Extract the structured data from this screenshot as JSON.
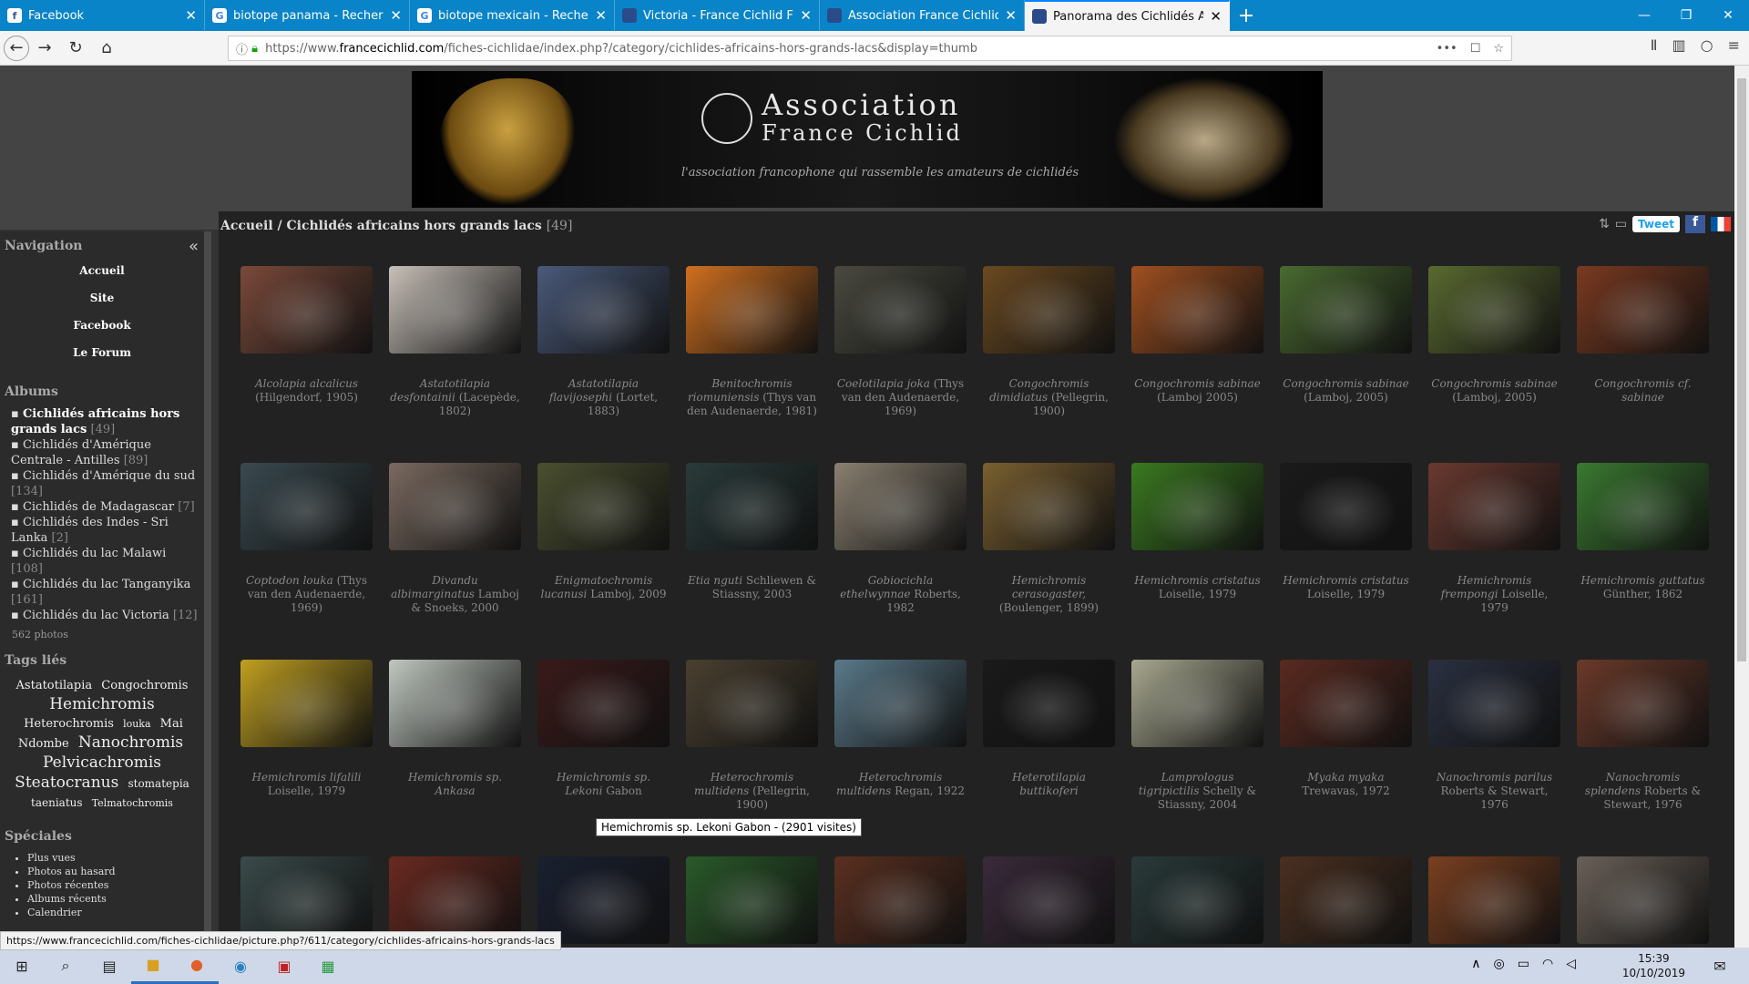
{
  "browser": {
    "tabs": [
      {
        "title": "Facebook",
        "icon": "facebook-icon"
      },
      {
        "title": "biotope panama - Recherche G",
        "icon": "google-icon"
      },
      {
        "title": "biotope mexicain - Recherche G",
        "icon": "google-icon"
      },
      {
        "title": "Victoria - France Cichlid Forum",
        "icon": "afc-icon"
      },
      {
        "title": "Association France Cichlid: les",
        "icon": "afc-icon"
      },
      {
        "title": "Panorama des Cichlidés AFC",
        "icon": "afc-icon",
        "active": true
      }
    ],
    "url_prefix": "https://www.",
    "url_domain": "francecichlid.com",
    "url_path": "/fiches-cichlidae/index.php?/category/cichlides-africains-hors-grands-lacs&display=thumb",
    "more": "•••"
  },
  "banner": {
    "line1": "Association",
    "line2": "France Cichlid",
    "tagline": "l'association francophone qui rassemble les amateurs de cichlidés"
  },
  "sidebar": {
    "nav_title": "Navigation",
    "nav": [
      "Accueil",
      "Site",
      "Facebook",
      "Le Forum"
    ],
    "albums_title": "Albums",
    "albums": [
      {
        "label": "Cichlidés africains hors grands lacs",
        "count": "[49]",
        "bold": true
      },
      {
        "label": "Cichlidés d'Amérique Centrale - Antilles",
        "count": "[89]"
      },
      {
        "label": "Cichlidés d'Amérique du sud",
        "count": "[134]"
      },
      {
        "label": "Cichlidés de Madagascar",
        "count": "[7]"
      },
      {
        "label": "Cichlidés des Indes - Sri Lanka",
        "count": "[2]"
      },
      {
        "label": "Cichlidés du lac Malawi",
        "count": "[108]"
      },
      {
        "label": "Cichlidés du lac Tanganyika",
        "count": "[161]"
      },
      {
        "label": "Cichlidés du lac Victoria",
        "count": "[12]"
      }
    ],
    "photos": "562 photos",
    "tags_title": "Tags liés",
    "tags": [
      "Astatotilapia",
      "Congochromis",
      "Hemichromis",
      "Heterochromis",
      "louka",
      "Mai Ndombe",
      "Nanochromis",
      "Pelvicachromis",
      "Steatocranus",
      "stomatepia",
      "taeniatus",
      "Telmatochromis"
    ],
    "special_title": "Spéciales",
    "special": [
      "Plus vues",
      "Photos au hasard",
      "Photos récentes",
      "Albums récents",
      "Calendrier"
    ]
  },
  "content": {
    "crumb_home": "Accueil",
    "crumb_sep": " / ",
    "crumb_cat": "Cichlidés africains hors grands lacs",
    "crumb_count": "[49]",
    "tweet": "Tweet",
    "tooltip": "Hemichromis sp. Lekoni Gabon - (2901 visites)",
    "status": "https://www.francecichlid.com/fiches-cichlidae/picture.php?/611/category/cichlides-africains-hors-grands-lacs",
    "photos": [
      {
        "name": "Alcolapia alcalicus",
        "auth": "(Hilgendorf, 1905)",
        "c": "#7a4a3a"
      },
      {
        "name": "Astatotilapia desfontainii",
        "auth": "(Lacepède, 1802)",
        "c": "#c8c0b8"
      },
      {
        "name": "Astatotilapia flavijosephi",
        "auth": "(Lortet, 1883)",
        "c": "#4a5a7a"
      },
      {
        "name": "Benitochromis riomuniensis",
        "auth": "(Thys van den Audenaerde, 1981)",
        "c": "#d07020"
      },
      {
        "name": "Coelotilapia joka",
        "auth": "(Thys van den Audenaerde, 1969)",
        "c": "#4a4a40"
      },
      {
        "name": "Congochromis dimidiatus",
        "auth": "(Pellegrin, 1900)",
        "c": "#6a4a20"
      },
      {
        "name": "Congochromis sabinae",
        "auth": "(Lamboj 2005)",
        "c": "#a05020"
      },
      {
        "name": "Congochromis sabinae",
        "auth": "(Lamboj, 2005)",
        "c": "#4a6a30"
      },
      {
        "name": "Congochromis sabinae",
        "auth": "(Lamboj, 2005)",
        "c": "#5a6a30"
      },
      {
        "name": "Congochromis cf. sabinae",
        "auth": "",
        "c": "#7a3a20"
      },
      {
        "name": "Coptodon louka",
        "auth": "(Thys van den Audenaerde, 1969)",
        "c": "#3a4a50"
      },
      {
        "name": "Divandu albimarginatus",
        "auth": "Lamboj & Snoeks, 2000",
        "c": "#7a6a60"
      },
      {
        "name": "Enigmatochromis lucanusi",
        "auth": "Lamboj, 2009",
        "c": "#4a5030"
      },
      {
        "name": "Etia nguti",
        "auth": "Schliewen & Stiassny, 2003",
        "c": "#2a3a3a"
      },
      {
        "name": "Gobiocichla ethelwynnae",
        "auth": "Roberts, 1982",
        "c": "#8a8070"
      },
      {
        "name": "Hemichromis cerasogaster,",
        "auth": "(Boulenger, 1899)",
        "c": "#7a6030"
      },
      {
        "name": "Hemichromis cristatus",
        "auth": "Loiselle, 1979",
        "c": "#3a7a20"
      },
      {
        "name": "Hemichromis cristatus",
        "auth": "Loiselle, 1979",
        "c": "#1a1a1a"
      },
      {
        "name": "Hemichromis frempongi",
        "auth": "Loiselle, 1979",
        "c": "#6a3a30"
      },
      {
        "name": "Hemichromis guttatus",
        "auth": "Günther, 1862",
        "c": "#3a7a30"
      },
      {
        "name": "Hemichromis lifalili",
        "auth": "Loiselle, 1979",
        "c": "#c0a020"
      },
      {
        "name": "Hemichromis sp. Ankasa",
        "auth": "",
        "c": "#c0c8c0"
      },
      {
        "name": "Hemichromis sp. Lekoni",
        "auth": "Gabon",
        "c": "#3a1a1a"
      },
      {
        "name": "Heterochromis multidens",
        "auth": "(Pellegrin, 1900)",
        "c": "#4a4030"
      },
      {
        "name": "Heterochromis multidens",
        "auth": "Regan, 1922",
        "c": "#5a7a8a"
      },
      {
        "name": "Heterotilapia buttikoferi",
        "auth": "",
        "c": "#1a1a1a"
      },
      {
        "name": "Lamprologus tigripictilis",
        "auth": "Schelly & Stiassny, 2004",
        "c": "#a8a890"
      },
      {
        "name": "Myaka myaka",
        "auth": "Trewavas, 1972",
        "c": "#5a2a20"
      },
      {
        "name": "Nanochromis parilus",
        "auth": "Roberts & Stewart, 1976",
        "c": "#2a3040"
      },
      {
        "name": "Nanochromis splendens",
        "auth": "Roberts & Stewart, 1976",
        "c": "#6a3a2a"
      },
      {
        "name": "",
        "auth": "",
        "c": "#3a4a4a"
      },
      {
        "name": "",
        "auth": "",
        "c": "#6a2a20"
      },
      {
        "name": "",
        "auth": "",
        "c": "#1a2030"
      },
      {
        "name": "",
        "auth": "",
        "c": "#2a5a2a"
      },
      {
        "name": "",
        "auth": "",
        "c": "#5a3020"
      },
      {
        "name": "",
        "auth": "",
        "c": "#3a2a3a"
      },
      {
        "name": "",
        "auth": "",
        "c": "#2a3a3a"
      },
      {
        "name": "",
        "auth": "",
        "c": "#4a3020"
      },
      {
        "name": "",
        "auth": "",
        "c": "#7a4020"
      },
      {
        "name": "",
        "auth": "",
        "c": "#6a6058"
      }
    ]
  },
  "taskbar": {
    "time": "15:39",
    "date": "10/10/2019"
  }
}
